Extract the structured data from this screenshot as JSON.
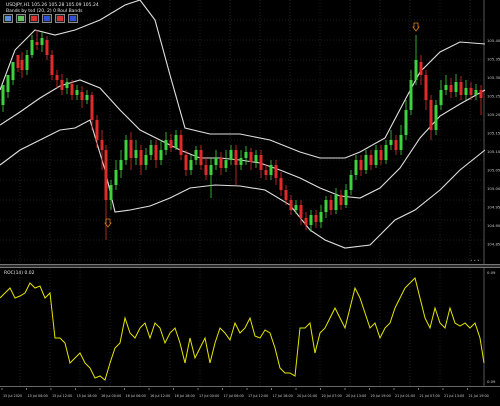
{
  "main_chart": {
    "info_line1": "USDJPY,H1  105.26  105.28  105.09  105.24",
    "info_line2": "Bands by tsd (20, 2) 0 Roul Bands"
  },
  "toolbar": {
    "buttons": [
      {
        "icon": "grid-icon",
        "color": "#5a8dd8"
      },
      {
        "icon": "candle-icon",
        "color": "#5ac85a"
      },
      {
        "icon": "red-square-icon",
        "color": "#d83030"
      },
      {
        "icon": "blue-square-icon",
        "color": "#3050d8"
      },
      {
        "icon": "red-square-icon",
        "color": "#d83030"
      },
      {
        "icon": "blue-square-icon",
        "color": "#3050d8"
      }
    ]
  },
  "price_axis_labels": [
    "105.40",
    "105.35",
    "105.30",
    "105.25",
    "105.20",
    "105.15",
    "105.10",
    "105.05",
    "105.00",
    "104.95",
    "104.90",
    "104.85"
  ],
  "indicator": {
    "label": "ROC(14) 0.02",
    "axis_top": "0.09",
    "axis_bottom": "0.09"
  },
  "time_labels": [
    "15 Jul 2020",
    "15 Jul 06:00",
    "15 Jul 12:00",
    "15 Jul 18:00",
    "16 Jul 00:00",
    "16 Jul 06:00",
    "16 Jul 12:00",
    "16 Jul 18:00",
    "17 Jul 00:00",
    "17 Jul 06:00",
    "17 Jul 12:00",
    "17 Jul 18:00",
    "20 Jul 01:00",
    "20 Jul 07:00",
    "20 Jul 13:00",
    "20 Jul 19:00",
    "21 Jul 01:00",
    "21 Jul 07:00",
    "21 Jul 13:00",
    "21 Jul 19:00"
  ],
  "colors": {
    "bull": "#3fd23f",
    "bear": "#e02b2b",
    "bands": "#e0e0e0",
    "roc": "#e6e600",
    "arrow": "#e08020"
  }
}
